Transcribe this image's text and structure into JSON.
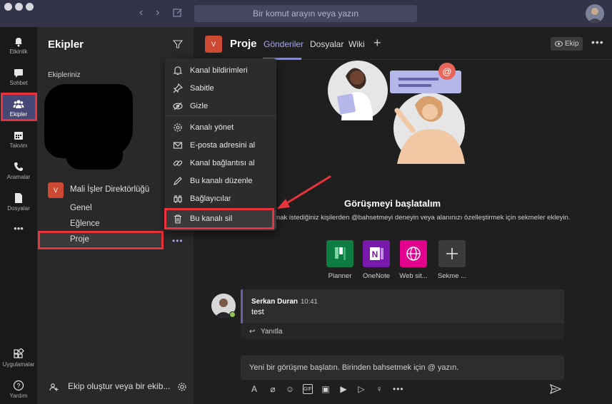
{
  "titlebar": {
    "search_placeholder": "Bir komut arayın veya yazın"
  },
  "appbar": {
    "items": [
      {
        "label": "Etkinlik",
        "icon": "bell-icon"
      },
      {
        "label": "Sohbet",
        "icon": "chat-icon"
      },
      {
        "label": "Ekipler",
        "icon": "teams-icon"
      },
      {
        "label": "Takvim",
        "icon": "calendar-icon"
      },
      {
        "label": "Aramalar",
        "icon": "phone-icon"
      },
      {
        "label": "Dosyalar",
        "icon": "file-icon"
      }
    ],
    "more": "•••",
    "apps_label": "Uygulamalar",
    "help_label": "Yardım"
  },
  "teams_pane": {
    "title": "Ekipler",
    "section_label": "Ekipleriniz",
    "team": {
      "badge": "V",
      "name": "Mali İşler Direktörlüğü"
    },
    "channels": [
      "Genel",
      "Eğlence",
      "Proje"
    ],
    "more_dots": "•••",
    "create_label": "Ekip oluştur veya bir ekib...",
    "create_icon": "create-team-icon"
  },
  "channel_header": {
    "badge": "V",
    "title": "Proje",
    "tabs": [
      "Gönderiler",
      "Dosyalar",
      "Wiki"
    ],
    "add_tab": "+",
    "ekip_button": "Ekip",
    "more": "•••"
  },
  "context_menu": {
    "items": [
      {
        "label": "Kanal bildirimleri",
        "icon": "bell-icon"
      },
      {
        "label": "Sabitle",
        "icon": "pin-icon"
      },
      {
        "label": "Gizle",
        "icon": "hide-icon"
      },
      {
        "label": "Kanalı yönet",
        "icon": "gear-icon"
      },
      {
        "label": "E-posta adresini al",
        "icon": "mail-icon"
      },
      {
        "label": "Kanal bağlantısı al",
        "icon": "link-icon"
      },
      {
        "label": "Bu kanalı düzenle",
        "icon": "pencil-icon"
      },
      {
        "label": "Bağlayıcılar",
        "icon": "connector-icon"
      },
      {
        "label": "Bu kanalı sil",
        "icon": "trash-icon"
      }
    ]
  },
  "main": {
    "hero_title": "Görüşmeyi başlatalım",
    "hero_subtitle": "omak istediğiniz kişilerden @bahsetmeyi deneyin veya alanınızı özelleştirmek için sekmeler ekleyin.",
    "apps": [
      {
        "label": "Planner",
        "color": "#0d7d41",
        "icon": "planner-icon"
      },
      {
        "label": "OneNote",
        "color": "#7719aa",
        "icon": "onenote-icon"
      },
      {
        "label": "Web sit...",
        "color": "#e3008c",
        "icon": "globe-icon"
      },
      {
        "label": "Sekme ...",
        "color": "#3b3b3b",
        "icon": "plus-icon"
      }
    ],
    "message": {
      "author": "Serkan Duran",
      "time": "10:41",
      "text": "test",
      "reply": "Yanıtla"
    },
    "compose_placeholder": "Yeni bir görüşme başlatın. Birinden bahsetmek için @ yazın."
  },
  "colors": {
    "accent": "#6264a7",
    "highlight_red": "#e8323c",
    "team_badge": "#cc4a31"
  }
}
